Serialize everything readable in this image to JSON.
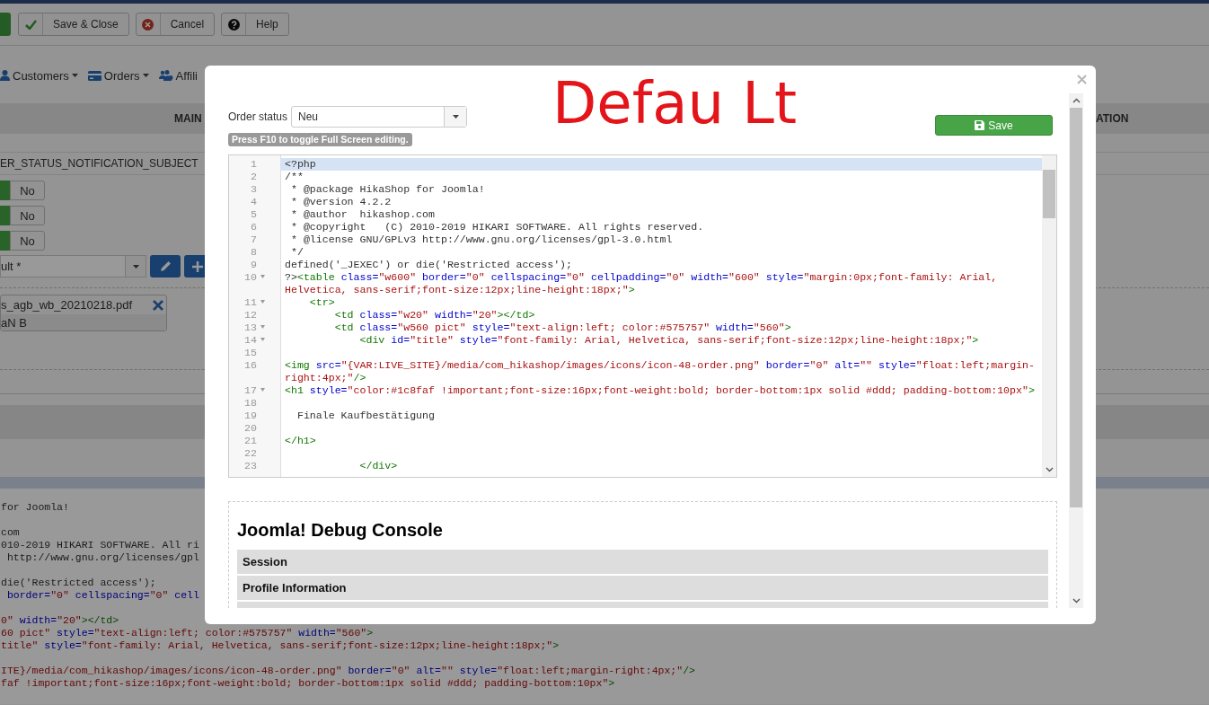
{
  "toolbar": [
    {
      "kind": "apply"
    },
    {
      "kind": "save",
      "label": "Save & Close"
    },
    {
      "kind": "cancel",
      "label": "Cancel"
    },
    {
      "kind": "help",
      "label": "Help"
    }
  ],
  "menu": [
    {
      "kind": "customers",
      "label": "Customers",
      "caret": true
    },
    {
      "kind": "orders",
      "label": "Orders",
      "caret": true
    },
    {
      "kind": "affiliates",
      "label": "Affili",
      "caret": false
    }
  ],
  "section_header": {
    "left": "MAIN",
    "right": "ATION"
  },
  "subject_key": "ER_STATUS_NOTIFICATION_SUBJECT",
  "toggles": [
    {
      "label": "No",
      "selected": false
    },
    {
      "label": "No",
      "selected": false
    },
    {
      "label": "No",
      "selected": false
    }
  ],
  "template_select": {
    "value": "ult *"
  },
  "attachment": {
    "filename": "s_agb_wb_20210218.pdf",
    "note": "aN B"
  },
  "background_code": [
    {
      "kind": "blank"
    },
    {
      "kind": "code",
      "segs": [
        {
          "kind": "text",
          "text": "for Joomla!"
        }
      ]
    },
    {
      "kind": "blank"
    },
    {
      "kind": "code",
      "segs": [
        {
          "kind": "text",
          "text": "com"
        }
      ]
    },
    {
      "kind": "code",
      "segs": [
        {
          "kind": "text",
          "text": "010-2019 HIKARI SOFTWARE. All ri"
        }
      ]
    },
    {
      "kind": "code",
      "segs": [
        {
          "kind": "text",
          "text": " http://www.gnu.org/licenses/gpl"
        }
      ]
    },
    {
      "kind": "blank"
    },
    {
      "kind": "code",
      "segs": [
        {
          "kind": "text",
          "text": "die('Restricted access');"
        }
      ]
    },
    {
      "kind": "code",
      "segs": [
        {
          "kind": "attr",
          "text": " border="
        },
        {
          "kind": "string",
          "text": "\"0\""
        },
        {
          "kind": "attr",
          "text": " cellspacing="
        },
        {
          "kind": "string",
          "text": "\"0\""
        },
        {
          "kind": "attr",
          "text": " cell"
        }
      ]
    },
    {
      "kind": "blank"
    },
    {
      "kind": "code",
      "segs": [
        {
          "kind": "string",
          "text": "0\""
        },
        {
          "kind": "attr",
          "text": " width="
        },
        {
          "kind": "string",
          "text": "\"20\""
        },
        {
          "kind": "tag",
          "text": "></td>"
        }
      ]
    },
    {
      "kind": "code",
      "segs": [
        {
          "kind": "string",
          "text": "60 pict\""
        },
        {
          "kind": "attr",
          "text": " style="
        },
        {
          "kind": "string",
          "text": "\"text-align:left; color:#575757\""
        },
        {
          "kind": "attr",
          "text": " width="
        },
        {
          "kind": "string",
          "text": "\"560\""
        },
        {
          "kind": "tag",
          "text": ">"
        }
      ]
    },
    {
      "kind": "code",
      "segs": [
        {
          "kind": "string",
          "text": "title\""
        },
        {
          "kind": "attr",
          "text": " style="
        },
        {
          "kind": "string",
          "text": "\"font-family: Arial, Helvetica, sans-serif;font-size:12px;line-height:18px;\""
        },
        {
          "kind": "tag",
          "text": ">"
        }
      ]
    },
    {
      "kind": "blank"
    },
    {
      "kind": "code",
      "segs": [
        {
          "kind": "string",
          "text": "ITE}/media/com_hikashop/images/icons/icon-48-order.png\""
        },
        {
          "kind": "attr",
          "text": " border="
        },
        {
          "kind": "string",
          "text": "\"0\""
        },
        {
          "kind": "attr",
          "text": " alt="
        },
        {
          "kind": "string",
          "text": "\"\""
        },
        {
          "kind": "attr",
          "text": " style="
        },
        {
          "kind": "string",
          "text": "\"float:left;margin-right:4px;\""
        },
        {
          "kind": "tag",
          "text": "/>"
        }
      ]
    },
    {
      "kind": "code",
      "segs": [
        {
          "kind": "string",
          "text": "faf !important;font-size:16px;font-weight:bold; border-bottom:1px solid #ddd; padding-bottom:10px\""
        },
        {
          "kind": "tag",
          "text": ">"
        }
      ]
    }
  ],
  "modal": {
    "annotation": "Defau Lt",
    "order_status_label": "Order status",
    "order_status_value": "Neu",
    "hint": "Press F10 to toggle Full Screen editing.",
    "save_label": "Save",
    "editor": {
      "lines": [
        {
          "num": "1",
          "fold": false,
          "active": true,
          "segs": [
            {
              "kind": "text",
              "text": "<?php"
            }
          ]
        },
        {
          "num": "2",
          "fold": false,
          "active": false,
          "segs": [
            {
              "kind": "text",
              "text": "/**"
            }
          ]
        },
        {
          "num": "3",
          "fold": false,
          "active": false,
          "segs": [
            {
              "kind": "text",
              "text": " * @package HikaShop for Joomla!"
            }
          ]
        },
        {
          "num": "4",
          "fold": false,
          "active": false,
          "segs": [
            {
              "kind": "text",
              "text": " * @version 4.2.2"
            }
          ]
        },
        {
          "num": "5",
          "fold": false,
          "active": false,
          "segs": [
            {
              "kind": "text",
              "text": " * @author  hikashop.com"
            }
          ]
        },
        {
          "num": "6",
          "fold": false,
          "active": false,
          "segs": [
            {
              "kind": "text",
              "text": " * @copyright   (C) 2010-2019 HIKARI SOFTWARE. All rights reserved."
            }
          ]
        },
        {
          "num": "7",
          "fold": false,
          "active": false,
          "segs": [
            {
              "kind": "text",
              "text": " * @license GNU/GPLv3 http://www.gnu.org/licenses/gpl-3.0.html"
            }
          ]
        },
        {
          "num": "8",
          "fold": false,
          "active": false,
          "segs": [
            {
              "kind": "text",
              "text": " */"
            }
          ]
        },
        {
          "num": "9",
          "fold": false,
          "active": false,
          "segs": [
            {
              "kind": "text",
              "text": "defined('_JEXEC') or die('Restricted access');"
            }
          ]
        },
        {
          "num": "10",
          "fold": true,
          "active": false,
          "segs": [
            {
              "kind": "text",
              "text": "?>"
            },
            {
              "kind": "tag",
              "text": "<table"
            },
            {
              "kind": "attr",
              "text": " class="
            },
            {
              "kind": "string",
              "text": "\"w600\""
            },
            {
              "kind": "attr",
              "text": " border="
            },
            {
              "kind": "string",
              "text": "\"0\""
            },
            {
              "kind": "attr",
              "text": " cellspacing="
            },
            {
              "kind": "string",
              "text": "\"0\""
            },
            {
              "kind": "attr",
              "text": " cellpadding="
            },
            {
              "kind": "string",
              "text": "\"0\""
            },
            {
              "kind": "attr",
              "text": " width="
            },
            {
              "kind": "string",
              "text": "\"600\""
            },
            {
              "kind": "attr",
              "text": " style="
            },
            {
              "kind": "string",
              "text": "\"margin:0px;font-family: Arial, Helvetica, sans-serif;font-size:12px;line-height:18px;\""
            },
            {
              "kind": "tag",
              "text": ">"
            }
          ]
        },
        {
          "num": "11",
          "fold": true,
          "active": false,
          "segs": [
            {
              "kind": "tag",
              "text": "    <tr>"
            }
          ]
        },
        {
          "num": "12",
          "fold": false,
          "active": false,
          "segs": [
            {
              "kind": "tag",
              "text": "        <td"
            },
            {
              "kind": "attr",
              "text": " class="
            },
            {
              "kind": "string",
              "text": "\"w20\""
            },
            {
              "kind": "attr",
              "text": " width="
            },
            {
              "kind": "string",
              "text": "\"20\""
            },
            {
              "kind": "tag",
              "text": "></td>"
            }
          ]
        },
        {
          "num": "13",
          "fold": true,
          "active": false,
          "segs": [
            {
              "kind": "tag",
              "text": "        <td"
            },
            {
              "kind": "attr",
              "text": " class="
            },
            {
              "kind": "string",
              "text": "\"w560 pict\""
            },
            {
              "kind": "attr",
              "text": " style="
            },
            {
              "kind": "string",
              "text": "\"text-align:left; color:#575757\""
            },
            {
              "kind": "attr",
              "text": " width="
            },
            {
              "kind": "string",
              "text": "\"560\""
            },
            {
              "kind": "tag",
              "text": ">"
            }
          ]
        },
        {
          "num": "14",
          "fold": true,
          "active": false,
          "segs": [
            {
              "kind": "tag",
              "text": "            <div"
            },
            {
              "kind": "attr",
              "text": " id="
            },
            {
              "kind": "string",
              "text": "\"title\""
            },
            {
              "kind": "attr",
              "text": " style="
            },
            {
              "kind": "string",
              "text": "\"font-family: Arial, Helvetica, sans-serif;font-size:12px;line-height:18px;\""
            },
            {
              "kind": "tag",
              "text": ">"
            }
          ]
        },
        {
          "num": "15",
          "fold": false,
          "active": false
        },
        {
          "num": "16",
          "fold": false,
          "active": false,
          "segs": [
            {
              "kind": "tag",
              "text": "<img"
            },
            {
              "kind": "attr",
              "text": " src="
            },
            {
              "kind": "string",
              "text": "\"{VAR:LIVE_SITE}/media/com_hikashop/images/icons/icon-48-order.png\""
            },
            {
              "kind": "attr",
              "text": " border="
            },
            {
              "kind": "string",
              "text": "\"0\""
            },
            {
              "kind": "attr",
              "text": " alt="
            },
            {
              "kind": "string",
              "text": "\"\""
            },
            {
              "kind": "attr",
              "text": " style="
            },
            {
              "kind": "string",
              "text": "\"float:left;margin-right:4px;\""
            },
            {
              "kind": "tag",
              "text": "/>"
            }
          ]
        },
        {
          "num": "17",
          "fold": true,
          "active": false,
          "segs": [
            {
              "kind": "tag",
              "text": "<h1"
            },
            {
              "kind": "attr",
              "text": " style="
            },
            {
              "kind": "string",
              "text": "\"color:#1c8faf !important;font-size:16px;font-weight:bold; border-bottom:1px solid #ddd; padding-bottom:10px\""
            },
            {
              "kind": "tag",
              "text": ">"
            }
          ]
        },
        {
          "num": "18",
          "fold": false,
          "active": false
        },
        {
          "num": "19",
          "fold": false,
          "active": false,
          "segs": [
            {
              "kind": "text",
              "text": "  Finale Kaufbestätigung"
            }
          ]
        },
        {
          "num": "20",
          "fold": false,
          "active": false
        },
        {
          "num": "21",
          "fold": false,
          "active": false,
          "segs": [
            {
              "kind": "tag",
              "text": "</h1>"
            }
          ]
        },
        {
          "num": "22",
          "fold": false,
          "active": false
        },
        {
          "num": "23",
          "fold": false,
          "active": false,
          "segs": [
            {
              "kind": "tag",
              "text": "            </div>"
            }
          ]
        }
      ]
    },
    "debug": {
      "title": "Joomla! Debug Console",
      "sections": [
        {
          "kind": "section",
          "label": "Session"
        },
        {
          "kind": "section",
          "label": "Profile Information"
        },
        {
          "kind": "cut"
        }
      ]
    }
  }
}
